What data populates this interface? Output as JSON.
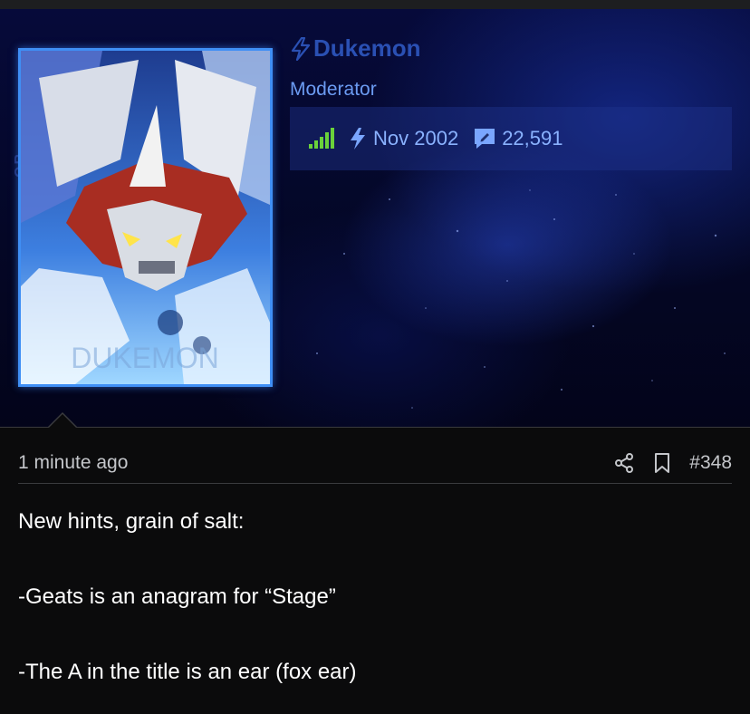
{
  "banner": {
    "side_text": "OR",
    "avatar_watermark": "DUKEMON"
  },
  "user": {
    "name": "Dukemon",
    "role": "Moderator",
    "joined": "Nov 2002",
    "messages": "22,591"
  },
  "icons": {
    "username_icon": "lightning-icon",
    "activity_icon": "signal-bars-icon",
    "joined_icon": "lightning-icon",
    "messages_icon": "message-edit-icon",
    "share_icon": "share-icon",
    "bookmark_icon": "bookmark-icon"
  },
  "colors": {
    "username": "#2a50b3",
    "role": "#6b9bf2",
    "stats": "#8ab2ff",
    "activity": "#6ad23a",
    "frame": "#3f8ff5"
  },
  "post": {
    "time": "1 minute ago",
    "number": "#348",
    "lines": [
      "New hints, grain of salt:",
      "-Geats is an anagram for “Stage”",
      "-The A in the title is an ear (fox ear)"
    ]
  }
}
